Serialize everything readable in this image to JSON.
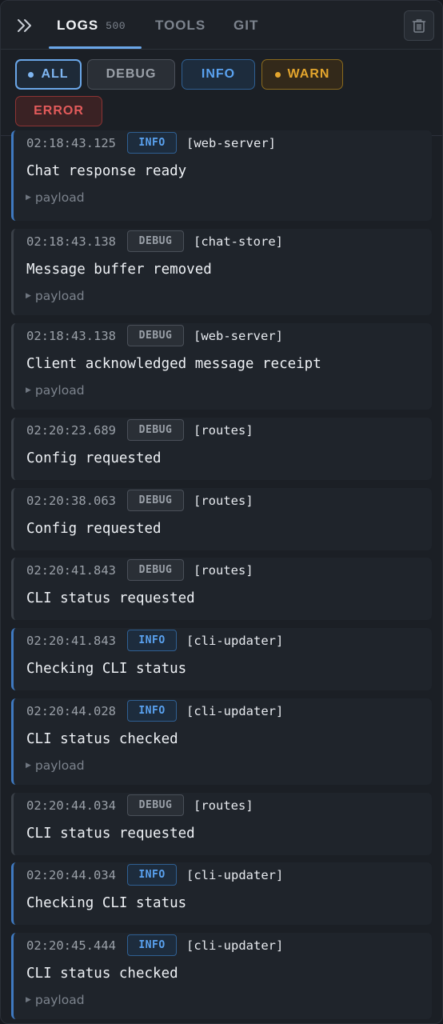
{
  "header": {
    "tabs": [
      {
        "label": "LOGS",
        "count": "500",
        "active": true
      },
      {
        "label": "TOOLS"
      },
      {
        "label": "GIT"
      }
    ]
  },
  "icons": {
    "collapse": "chevrons-right-icon",
    "trash": "trash-icon",
    "payload_toggle": "triangle-right-icon"
  },
  "filters": {
    "all": "ALL",
    "debug": "DEBUG",
    "info": "INFO",
    "warn": "WARN",
    "error": "ERROR"
  },
  "colors": {
    "accent_blue": "#6aa6e8",
    "info": "#5aa2f0",
    "warn": "#e3a52d",
    "error": "#e35b5b",
    "debug": "#9aa0a8"
  },
  "payload_label": "payload",
  "logs": [
    {
      "time": "02:18:43.125",
      "level": "INFO",
      "source": "[web-server]",
      "message": "Chat response ready",
      "payload": "payload"
    },
    {
      "time": "02:18:43.138",
      "level": "DEBUG",
      "source": "[chat-store]",
      "message": "Message buffer removed",
      "payload": "payload"
    },
    {
      "time": "02:18:43.138",
      "level": "DEBUG",
      "source": "[web-server]",
      "message": "Client acknowledged message receipt",
      "payload": "payload"
    },
    {
      "time": "02:20:23.689",
      "level": "DEBUG",
      "source": "[routes]",
      "message": "Config requested"
    },
    {
      "time": "02:20:38.063",
      "level": "DEBUG",
      "source": "[routes]",
      "message": "Config requested"
    },
    {
      "time": "02:20:41.843",
      "level": "DEBUG",
      "source": "[routes]",
      "message": "CLI status requested"
    },
    {
      "time": "02:20:41.843",
      "level": "INFO",
      "source": "[cli-updater]",
      "message": "Checking CLI status"
    },
    {
      "time": "02:20:44.028",
      "level": "INFO",
      "source": "[cli-updater]",
      "message": "CLI status checked",
      "payload": "payload"
    },
    {
      "time": "02:20:44.034",
      "level": "DEBUG",
      "source": "[routes]",
      "message": "CLI status requested"
    },
    {
      "time": "02:20:44.034",
      "level": "INFO",
      "source": "[cli-updater]",
      "message": "Checking CLI status"
    },
    {
      "time": "02:20:45.444",
      "level": "INFO",
      "source": "[cli-updater]",
      "message": "CLI status checked",
      "payload": "payload"
    }
  ]
}
